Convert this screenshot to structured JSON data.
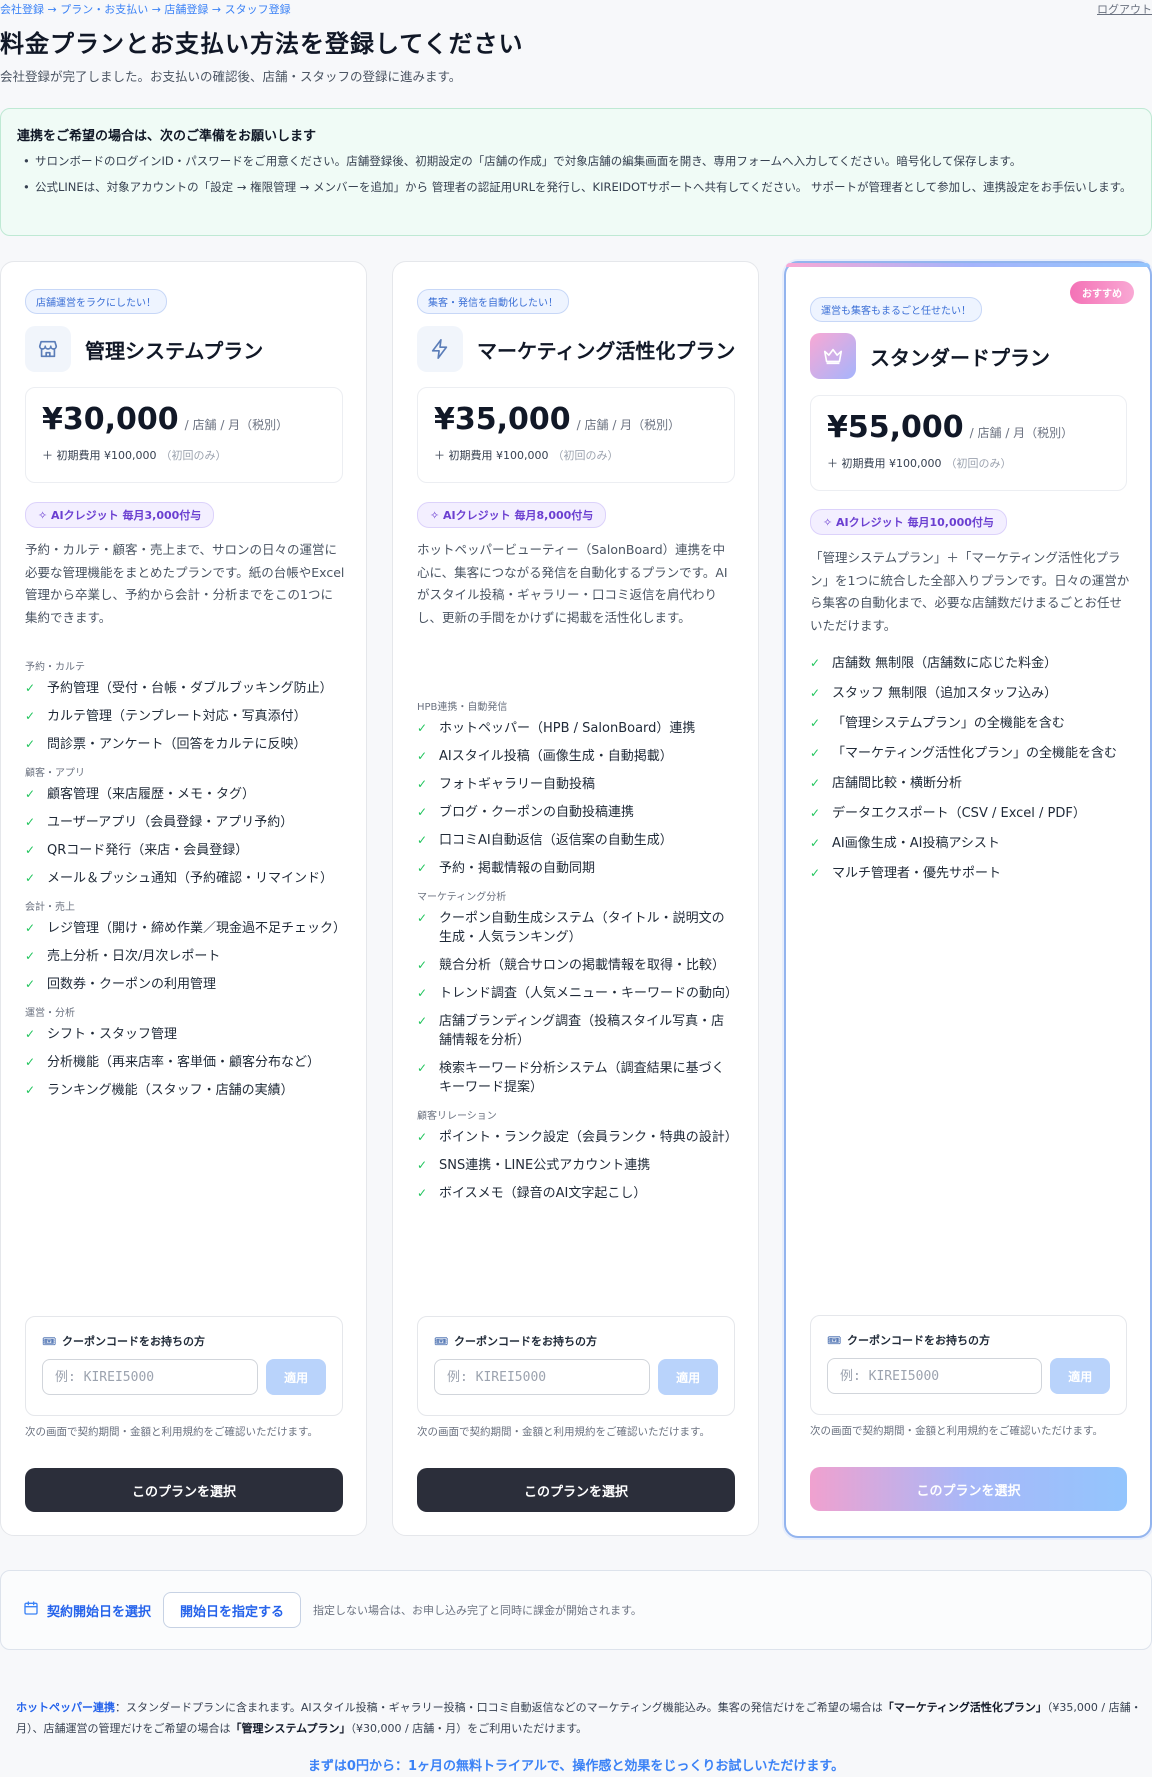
{
  "header": {
    "breadcrumb": "会社登録 → プラン・お支払い → 店舗登録 → スタッフ登録",
    "logout": "ログアウト",
    "title": "料金プランとお支払い方法を登録してください",
    "subtitle": "会社登録が完了しました。お支払いの確認後、店舗・スタッフの登録に進みます。"
  },
  "notice": {
    "title": "連携をご希望の場合は、次のご準備をお願いします",
    "items": [
      "サロンボードのログインID・パスワードをご用意ください。店舗登録後、初期設定の「店舗の作成」で対象店舗の編集画面を開き、専用フォームへ入力してください。暗号化して保存します。",
      "公式LINEは、対象アカウントの「設定 → 権限管理 → メンバーを追加」から 管理者の認証用URLを発行し、KIREIDOTサポートへ共有してください。 サポートが管理者として参加し、連携設定をお手伝いします。"
    ]
  },
  "plans": [
    {
      "tag": "店舗運営をラクにしたい！",
      "icon": "store-icon",
      "name": "管理システムプラン",
      "price": "¥30,000",
      "price_unit": "/ 店舗 / 月（税別）",
      "initial": "＋ 初期費用 ¥100,000",
      "initial_note": "（初回のみ）",
      "credit": "AIクレジット 毎月3,000付与",
      "description": "予約・カルテ・顧客・売上まで、サロンの日々の運営に必要な管理機能をまとめたプランです。紙の台帳やExcel管理から卒業し、予約から会計・分析までをこの1つに集約できます。",
      "sections": [
        {
          "label": "予約・カルテ",
          "items": [
            "予約管理（受付・台帳・ダブルブッキング防止）",
            "カルテ管理（テンプレート対応・写真添付）",
            "問診票・アンケート（回答をカルテに反映）"
          ]
        },
        {
          "label": "顧客・アプリ",
          "items": [
            "顧客管理（来店履歴・メモ・タグ）",
            "ユーザーアプリ（会員登録・アプリ予約）",
            "QRコード発行（来店・会員登録）",
            "メール＆プッシュ通知（予約確認・リマインド）"
          ]
        },
        {
          "label": "会計・売上",
          "items": [
            "レジ管理（開け・締め作業／現金過不足チェック）",
            "売上分析・日次/月次レポート",
            "回数券・クーポンの利用管理"
          ]
        },
        {
          "label": "運営・分析",
          "items": [
            "シフト・スタッフ管理",
            "分析機能（再来店率・客単価・顧客分布など）",
            "ランキング機能（スタッフ・店舗の実績）"
          ]
        }
      ],
      "coupon_label": "クーポンコードをお持ちの方",
      "coupon_placeholder": "例: KIREI5000",
      "apply": "適用",
      "note": "次の画面で契約期間・金額と利用規約をご確認いただけます。",
      "select": "このプランを選択"
    },
    {
      "tag": "集客・発信を自動化したい！",
      "icon": "bolt-icon",
      "name": "マーケティング活性化プラン",
      "price": "¥35,000",
      "price_unit": "/ 店舗 / 月（税別）",
      "initial": "＋ 初期費用 ¥100,000",
      "initial_note": "（初回のみ）",
      "credit": "AIクレジット 毎月8,000付与",
      "description": "ホットペッパービューティー（SalonBoard）連携を中心に、集客につながる発信を自動化するプランです。AIがスタイル投稿・ギャラリー・口コミ返信を肩代わりし、更新の手間をかけずに掲載を活性化します。",
      "sections": [
        {
          "label": "HPB連携・自動発信",
          "items": [
            "ホットペッパー（HPB / SalonBoard）連携",
            "AIスタイル投稿（画像生成・自動掲載）",
            "フォトギャラリー自動投稿",
            "ブログ・クーポンの自動投稿連携",
            "口コミAI自動返信（返信案の自動生成）",
            "予約・掲載情報の自動同期"
          ]
        },
        {
          "label": "マーケティング分析",
          "items": [
            "クーポン自動生成システム（タイトル・説明文の生成・人気ランキング）",
            "競合分析（競合サロンの掲載情報を取得・比較）",
            "トレンド調査（人気メニュー・キーワードの動向）",
            "店舗ブランディング調査（投稿スタイル写真・店舗情報を分析）",
            "検索キーワード分析システム（調査結果に基づくキーワード提案）"
          ]
        },
        {
          "label": "顧客リレーション",
          "items": [
            "ポイント・ランク設定（会員ランク・特典の設計）",
            "SNS連携・LINE公式アカウント連携",
            "ボイスメモ（録音のAI文字起こし）"
          ]
        }
      ],
      "coupon_label": "クーポンコードをお持ちの方",
      "coupon_placeholder": "例: KIREI5000",
      "apply": "適用",
      "note": "次の画面で契約期間・金額と利用規約をご確認いただけます。",
      "select": "このプランを選択"
    },
    {
      "tag": "運営も集客もまるごと任せたい！",
      "ribbon": "おすすめ",
      "icon": "crown-icon",
      "name": "スタンダードプラン",
      "price": "¥55,000",
      "price_unit": "/ 店舗 / 月（税別）",
      "initial": "＋ 初期費用 ¥100,000",
      "initial_note": "（初回のみ）",
      "credit": "AIクレジット 毎月10,000付与",
      "description": "「管理システムプラン」＋「マーケティング活性化プラン」を1つに統合した全部入りプランです。日々の運営から集客の自動化まで、必要な店舗数だけまるごとお任せいただけます。",
      "sections": [
        {
          "label": "",
          "items": [
            "店舗数 無制限（店舗数に応じた料金）",
            "スタッフ 無制限（追加スタッフ込み）",
            "「管理システムプラン」の全機能を含む",
            "「マーケティング活性化プラン」の全機能を含む",
            "店舗間比較・横断分析",
            "データエクスポート（CSV / Excel / PDF）",
            "AI画像生成・AI投稿アシスト",
            "マルチ管理者・優先サポート"
          ]
        }
      ],
      "coupon_label": "クーポンコードをお持ちの方",
      "coupon_placeholder": "例: KIREI5000",
      "apply": "適用",
      "note": "次の画面で契約期間・金額と利用規約をご確認いただけます。",
      "select": "このプランを選択"
    }
  ],
  "start": {
    "label": "契約開始日を選択",
    "button": "開始日を指定する",
    "hint": "指定しない場合は、お申し込み完了と同時に課金が開始されます。"
  },
  "footer": {
    "hpb_link": "ホットペッパー連携",
    "text1": "：スタンダードプランに含まれます。AIスタイル投稿・ギャラリー投稿・口コミ自動返信などのマーケティング機能込み。集客の発信だけをご希望の場合は",
    "bold1": "「マーケティング活性化プラン」",
    "text2": "（¥35,000 / 店舗・月）、店舗運営の管理だけをご希望の場合は",
    "bold2": "「管理システムプラン」",
    "text3": "（¥30,000 / 店舗・月）をご利用いただけます。",
    "trial": "まずは0円から：1ヶ月の無料トライアルで、操作感と効果をじっくりお試しいただけます。"
  },
  "colors": {
    "accent": "#3b82f6",
    "dark_button": "#2b2e3a",
    "check": "#22c55e"
  }
}
